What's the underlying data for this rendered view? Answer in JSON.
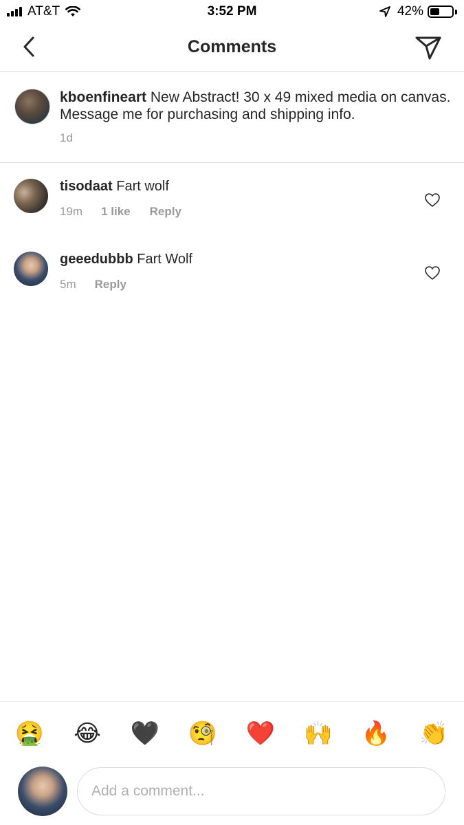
{
  "status_bar": {
    "carrier": "AT&T",
    "time": "3:52 PM",
    "battery": "42%",
    "battery_level": 0.42
  },
  "header": {
    "title": "Comments"
  },
  "caption": {
    "username": "kboenfineart",
    "text": " New Abstract! 30 x 49 mixed media on canvas. Message me for purchasing and shipping info.",
    "time": "1d"
  },
  "comments": [
    {
      "username": "tisodaat",
      "text": " Fart wolf",
      "time": "19m",
      "likes": "1 like",
      "reply": "Reply"
    },
    {
      "username": "geeedubbb",
      "text": " Fart Wolf",
      "time": "5m",
      "reply": "Reply"
    }
  ],
  "emoji_bar": [
    "🤮",
    "😂",
    "🖤",
    "🧐",
    "❤️",
    "🙌",
    "🔥",
    "👏"
  ],
  "input": {
    "placeholder": "Add a comment..."
  },
  "icons": {
    "back": "chevron-left-icon",
    "send": "paper-plane-icon",
    "heart": "heart-outline-icon"
  }
}
